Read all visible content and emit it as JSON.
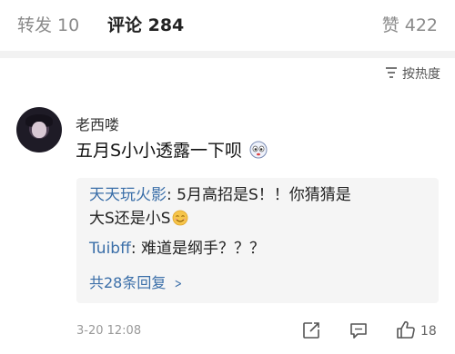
{
  "tabs": {
    "repost": "转发 10",
    "comment": "评论 284",
    "like": "赞 422"
  },
  "sort": {
    "label": "按热度",
    "icon": "sort-lines-icon"
  },
  "comment": {
    "username": "老西喽",
    "text": "五月S小小透露一下呗",
    "emoji": "face-emoji",
    "time": "3-20 12:08",
    "like_count": "18"
  },
  "replies": [
    {
      "author": "天天玩火影",
      "text_line1": ": 5月高招是S！！你猜猜是",
      "text_line2": "大S还是小S",
      "emoji": "smile-emoji"
    },
    {
      "author": "Tuibff",
      "text": ": 难道是纲手？？？"
    }
  ],
  "more_replies": "共28条回复",
  "colors": {
    "link": "#3a6ea8",
    "muted": "#8a8a8a",
    "reply_bg": "#f5f5f5"
  }
}
